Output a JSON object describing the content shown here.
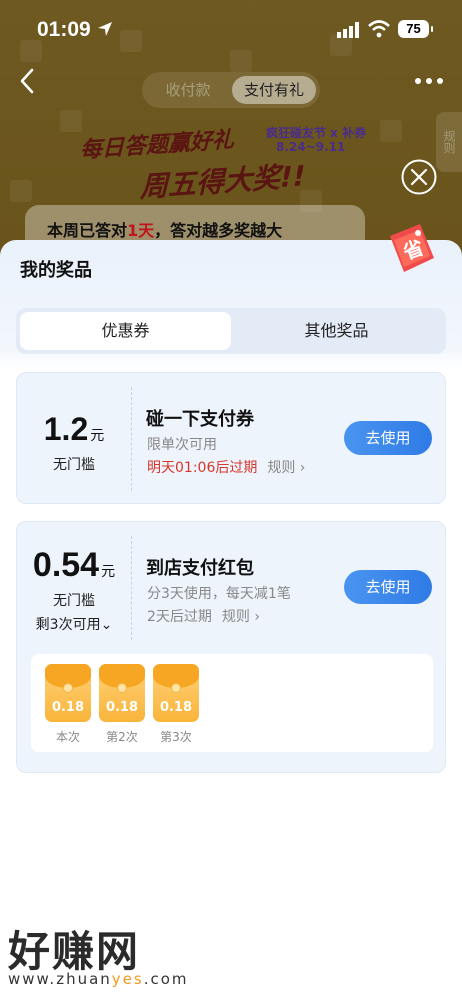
{
  "status_bar": {
    "time": "01:09",
    "battery": "75"
  },
  "header": {
    "segments": [
      "收付款",
      "支付有礼"
    ],
    "active_segment": "支付有礼"
  },
  "banner": {
    "line1": "每日答题赢好礼",
    "line2": "周五得大奖!!",
    "sub": "疯狂碰友节 x 补券",
    "date": "8.24~9.11",
    "side_tab": "规则"
  },
  "quiz": {
    "prefix": "本周已答对",
    "highlight": "1天",
    "suffix": "，答对越多奖越大"
  },
  "badge": {
    "text": "省"
  },
  "sheet": {
    "title": "我的奖品",
    "tabs": [
      {
        "label": "优惠券",
        "active": true
      },
      {
        "label": "其他奖品",
        "active": false
      }
    ]
  },
  "coupons": [
    {
      "amount": "1.2",
      "unit": "元",
      "threshold": "无门槛",
      "title": "碰一下支付券",
      "desc": "限单次可用",
      "expire": "明天01:06后过期",
      "rule": "规则 ›",
      "button": "去使用"
    },
    {
      "amount": "0.54",
      "unit": "元",
      "threshold": "无门槛",
      "remain": "剩3次可用⌄",
      "title": "到店支付红包",
      "desc": "分3天使用，每天减1笔",
      "expire": "2天后过期",
      "rule": "规则 ›",
      "button": "去使用",
      "packets": [
        {
          "value": "0.18",
          "label": "本次"
        },
        {
          "value": "0.18",
          "label": "第2次"
        },
        {
          "value": "0.18",
          "label": "第3次"
        }
      ]
    }
  ],
  "watermark": {
    "name": "好赚网",
    "url_a": "www.zhuan",
    "url_b": "yes",
    "url_c": ".com"
  },
  "colors": {
    "accent_blue": "#2f7be6",
    "expire_red": "#d8362b",
    "packet_orange": "#f9b43a"
  }
}
